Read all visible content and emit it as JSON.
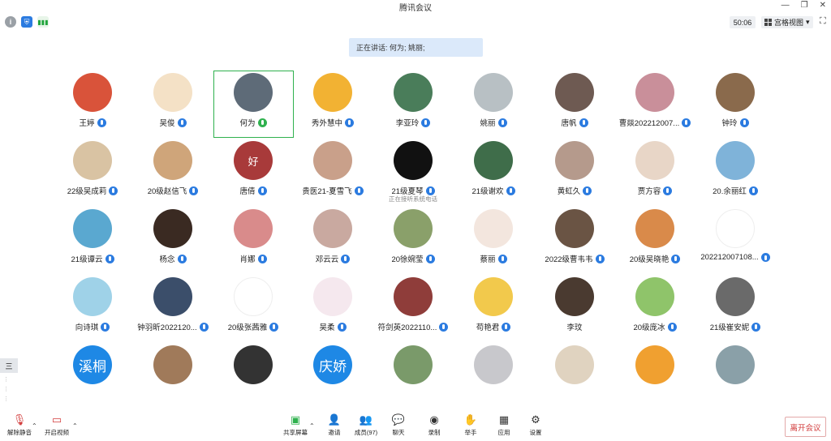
{
  "window": {
    "title": "腾讯会议",
    "minimize": "—",
    "restore": "❐",
    "close": "✕"
  },
  "status": {
    "timer": "50:06",
    "view_mode": "宫格视图"
  },
  "speaking": "正在讲话: 何为; 姚丽;",
  "participants": [
    {
      "name": "王婷",
      "mic": "on",
      "avatar": "#d9533a"
    },
    {
      "name": "吴俊",
      "mic": "on",
      "avatar": "#f4e1c6"
    },
    {
      "name": "何为",
      "mic": "speaking",
      "avatar": "#5e6b78",
      "active": true
    },
    {
      "name": "秀外慧中",
      "mic": "on",
      "avatar": "#f2b233"
    },
    {
      "name": "李亚玲",
      "mic": "on",
      "avatar": "#4a7d5a"
    },
    {
      "name": "姚丽",
      "mic": "speaking-blue",
      "avatar": "#b8c0c4"
    },
    {
      "name": "唐帆",
      "mic": "on",
      "avatar": "#6e5a52"
    },
    {
      "name": "曹燚202212007...",
      "mic": "on",
      "avatar": "#c98f9a"
    },
    {
      "name": "钟玲",
      "mic": "on",
      "avatar": "#8a6a4c"
    },
    {
      "name": "22级吴成莉",
      "mic": "on",
      "avatar": "#d9c3a3"
    },
    {
      "name": "20级赵信飞",
      "mic": "on",
      "avatar": "#cfa57a"
    },
    {
      "name": "唐倩",
      "mic": "on",
      "avatar": "#a83a3a",
      "avatar_text": "好"
    },
    {
      "name": "贵医21-夏雪飞",
      "mic": "on",
      "avatar": "#c9a08a"
    },
    {
      "name": "21级夏琴",
      "mic": "on",
      "avatar": "#111111",
      "sub": "正在接听系统电话"
    },
    {
      "name": "21级谢欢",
      "mic": "on",
      "avatar": "#3f6d4a"
    },
    {
      "name": "黄虹久",
      "mic": "on",
      "avatar": "#b59a8c"
    },
    {
      "name": "贾方容",
      "mic": "on",
      "avatar": "#e8d6c7"
    },
    {
      "name": "20.余丽红",
      "mic": "on",
      "avatar": "#7fb3d9"
    },
    {
      "name": "21级谭云",
      "mic": "on",
      "avatar": "#5aa8d0"
    },
    {
      "name": "杨念",
      "mic": "on",
      "avatar": "#3a2a22"
    },
    {
      "name": "肖娜",
      "mic": "on",
      "avatar": "#d98b8b"
    },
    {
      "name": "邓云云",
      "mic": "on",
      "avatar": "#c9a9a0"
    },
    {
      "name": "20徐婉莹",
      "mic": "on",
      "avatar": "#8aa06a"
    },
    {
      "name": "蔡丽",
      "mic": "on",
      "avatar": "#f3e6de"
    },
    {
      "name": "2022级曹韦韦",
      "mic": "on",
      "avatar": "#6a5444"
    },
    {
      "name": "20级吴晓艳",
      "mic": "on",
      "avatar": "#d98a4a"
    },
    {
      "name": "202212007108...",
      "mic": "on",
      "avatar": "#ffffff"
    },
    {
      "name": "向诗琪",
      "mic": "on",
      "avatar": "#9fd2e8"
    },
    {
      "name": "钟羽昕2022120...",
      "mic": "on",
      "avatar": "#3b4e6a"
    },
    {
      "name": "20级张茜雅",
      "mic": "on",
      "avatar": "#ffffff"
    },
    {
      "name": "吴柔",
      "mic": "on",
      "avatar": "#f5e8ee"
    },
    {
      "name": "符剑英2022110...",
      "mic": "on",
      "avatar": "#8f3d3a"
    },
    {
      "name": "苟艳君",
      "mic": "on",
      "avatar": "#f2c94c"
    },
    {
      "name": "李玟",
      "mic": "none",
      "avatar": "#4a3a30"
    },
    {
      "name": "20级庞冰",
      "mic": "on",
      "avatar": "#8fc46a"
    },
    {
      "name": "21级崔安妮",
      "mic": "on",
      "avatar": "#6a6a6a"
    },
    {
      "name": "",
      "mic": "none",
      "avatar": "#1e88e5",
      "avatar_text": "溪桐"
    },
    {
      "name": "",
      "mic": "none",
      "avatar": "#a07a5a"
    },
    {
      "name": "",
      "mic": "none",
      "avatar": "#333333"
    },
    {
      "name": "",
      "mic": "none",
      "avatar": "#1e88e5",
      "avatar_text": "庆娇"
    },
    {
      "name": "",
      "mic": "none",
      "avatar": "#7a9a6a"
    },
    {
      "name": "",
      "mic": "none",
      "avatar": "#c8c8cc"
    },
    {
      "name": "",
      "mic": "none",
      "avatar": "#e0d3c0"
    },
    {
      "name": "",
      "mic": "none",
      "avatar": "#f0a030"
    },
    {
      "name": "",
      "mic": "none",
      "avatar": "#8aa0a8"
    }
  ],
  "toolbar": {
    "mute": "解除静音",
    "video": "开启视频",
    "share": "共享屏幕",
    "invite": "邀请",
    "members": "成员(97)",
    "chat": "聊天",
    "record": "录制",
    "hand": "举手",
    "apps": "应用",
    "settings": "设置",
    "leave": "离开会议"
  },
  "side_tab": "三"
}
